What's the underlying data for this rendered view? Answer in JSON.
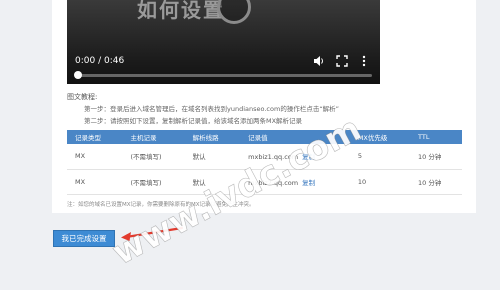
{
  "video": {
    "title_overlay": "如何设置",
    "current_time": "0:00",
    "duration": "0:46",
    "time_display": "0:00 / 0:46",
    "progress": 0.0
  },
  "guide": {
    "title": "图文教程:",
    "step1": "第一步：登录后进入域名管理后，在域名列表找到yundianseo.com的操作栏点击“解析”",
    "step2": "第二步：请按照如下设置，复制解析记录值，给该域名添加两条MX解析记录"
  },
  "table": {
    "headers": [
      "记录类型",
      "主机记录",
      "解析线路",
      "记录值",
      "MX优先级",
      "TTL"
    ],
    "edit_label": "复制",
    "rows": [
      {
        "type": "MX",
        "host": "(不需填写)",
        "line": "默认",
        "value": "mxbiz1.qq.com",
        "priority": "5",
        "ttl": "10 分钟"
      },
      {
        "type": "MX",
        "host": "(不需填写)",
        "line": "默认",
        "value": "mxbiz2.qq.com",
        "priority": "10",
        "ttl": "10 分钟"
      }
    ]
  },
  "note": "注：如您的域名已设置MX记录，你需要删除原有的MX记录以避免产生冲突。",
  "confirm_button": "我已完成设置",
  "watermark": "www.ivdc.com",
  "colors": {
    "table_header": "#4a86c6",
    "button": "#3d8bd4",
    "arrow": "#e23b2e",
    "link": "#3b7ac0"
  }
}
